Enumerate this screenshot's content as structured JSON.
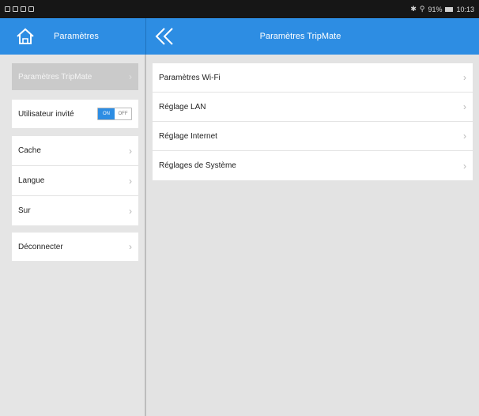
{
  "status_bar": {
    "battery": "91%",
    "time": "10:13",
    "icons": [
      "bluetooth-icon",
      "signal-icon",
      "battery-icon"
    ]
  },
  "header": {
    "left_title": "Paramètres",
    "center_title": "Paramètres TripMate"
  },
  "sidebar": {
    "selected": "Paramètres TripMate",
    "guest_label": "Utilisateur invité",
    "toggle_on": "ON",
    "toggle_off": "OFF",
    "items": [
      "Cache",
      "Langue",
      "Sur"
    ],
    "disconnect": "Déconnecter"
  },
  "main": {
    "items": [
      "Paramètres Wi-Fi",
      "Réglage LAN",
      "Réglage Internet",
      "Réglages de Système"
    ]
  },
  "colors": {
    "accent": "#2d8de3",
    "background": "#e5e5e5",
    "selected_row": "#cacaca"
  }
}
